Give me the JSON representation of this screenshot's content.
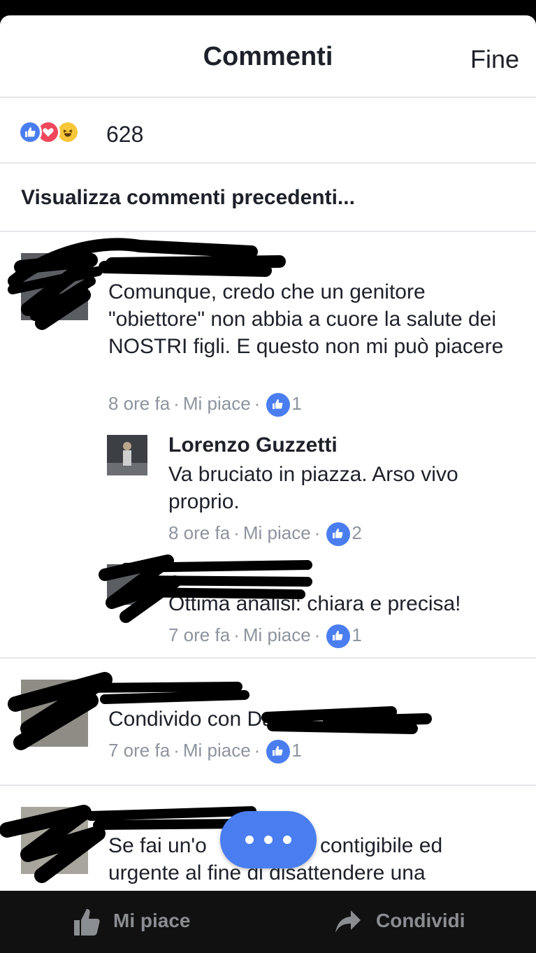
{
  "header": {
    "title": "Commenti",
    "done_label": "Fine"
  },
  "reactions": {
    "count": "628",
    "icons": [
      "like-icon",
      "love-icon",
      "haha-icon"
    ]
  },
  "prev_comments_label": "Visualizza commenti precedenti...",
  "comments": [
    {
      "name": "",
      "text": "Comunque, credo che un genitore \"obiettore\" non abbia a cuore la salute dei NOSTRI figli. E questo non mi può piacere",
      "time": "8 ore fa",
      "like_label": "Mi piace",
      "likes": "1",
      "replies": [
        {
          "name": "Lorenzo Guzzetti",
          "text": "Va bruciato in piazza. Arso vivo proprio.",
          "time": "8 ore fa",
          "like_label": "Mi piace",
          "likes": "2"
        },
        {
          "name": "",
          "text": "Ottima analisi: chiara e precisa!",
          "time": "7 ore fa",
          "like_label": "Mi piace",
          "likes": "1"
        }
      ]
    },
    {
      "name": "",
      "text": "Condivido con Da",
      "time": "7 ore fa",
      "like_label": "Mi piace",
      "likes": "1"
    },
    {
      "name": "",
      "text_line1_a": "Se fai un'o",
      "text_line1_b": "contigibile ed",
      "text_line2": "urgente al fine di disattendere una"
    }
  ],
  "bottom_bar": {
    "like_label": "Mi piace",
    "share_label": "Condividi"
  },
  "colors": {
    "accent": "#4a7ef0",
    "love": "#f0475a",
    "haha": "#f7c73a",
    "meta": "#8d949e"
  }
}
